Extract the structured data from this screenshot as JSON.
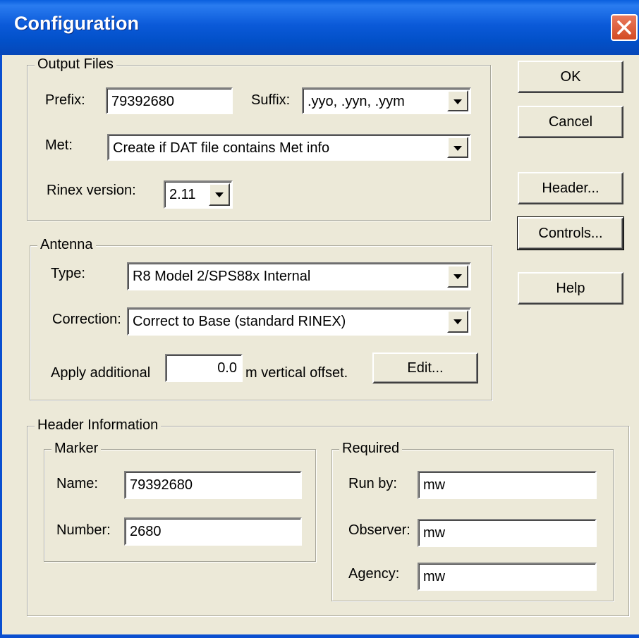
{
  "window": {
    "title": "Configuration"
  },
  "output_files": {
    "group_title": "Output Files",
    "prefix_label": "Prefix:",
    "prefix_value": "79392680",
    "suffix_label": "Suffix:",
    "suffix_value": ".yyo, .yyn, .yym",
    "met_label": "Met:",
    "met_value": "Create if DAT file contains Met info",
    "rinex_label": "Rinex version:",
    "rinex_value": "2.11"
  },
  "antenna": {
    "group_title": "Antenna",
    "type_label": "Type:",
    "type_value": "R8 Model 2/SPS88x Internal",
    "correction_label": "Correction:",
    "correction_value": "Correct to Base (standard RINEX)",
    "apply_label": "Apply additional",
    "offset_value": "0.0",
    "offset_suffix": "m vertical offset.",
    "edit_button": "Edit..."
  },
  "header_info": {
    "group_title": "Header Information",
    "marker": {
      "group_title": "Marker",
      "name_label": "Name:",
      "name_value": "79392680",
      "number_label": "Number:",
      "number_value": "2680"
    },
    "required": {
      "group_title": "Required",
      "run_by_label": "Run by:",
      "run_by_value": "mw",
      "observer_label": "Observer:",
      "observer_value": "mw",
      "agency_label": "Agency:",
      "agency_value": "mw"
    }
  },
  "buttons": {
    "ok": "OK",
    "cancel": "Cancel",
    "header": "Header...",
    "controls": "Controls...",
    "help": "Help"
  },
  "icons": {
    "close": "close-icon",
    "dropdown": "chevron-down-icon"
  },
  "colors": {
    "titlebar": "#0a5fde",
    "dialog_bg": "#ece9d8",
    "close_button": "#d34a22"
  }
}
